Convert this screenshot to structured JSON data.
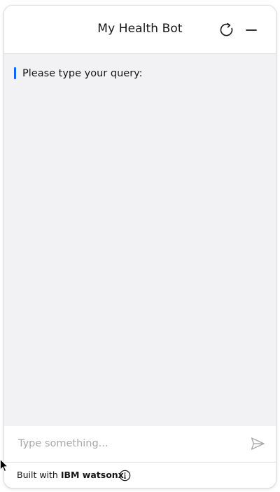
{
  "header": {
    "title": "My Health Bot",
    "restart_icon": "restart-icon",
    "minimize_icon": "minimize-icon"
  },
  "chat": {
    "messages": [
      {
        "text": "Please type your query:"
      }
    ],
    "accent_color": "#0f62fe"
  },
  "composer": {
    "placeholder": "Type something...",
    "value": "",
    "send_icon": "send-icon"
  },
  "footer": {
    "prefix": "Built with",
    "brand": "IBM watsonx",
    "info_icon": "info-icon"
  }
}
